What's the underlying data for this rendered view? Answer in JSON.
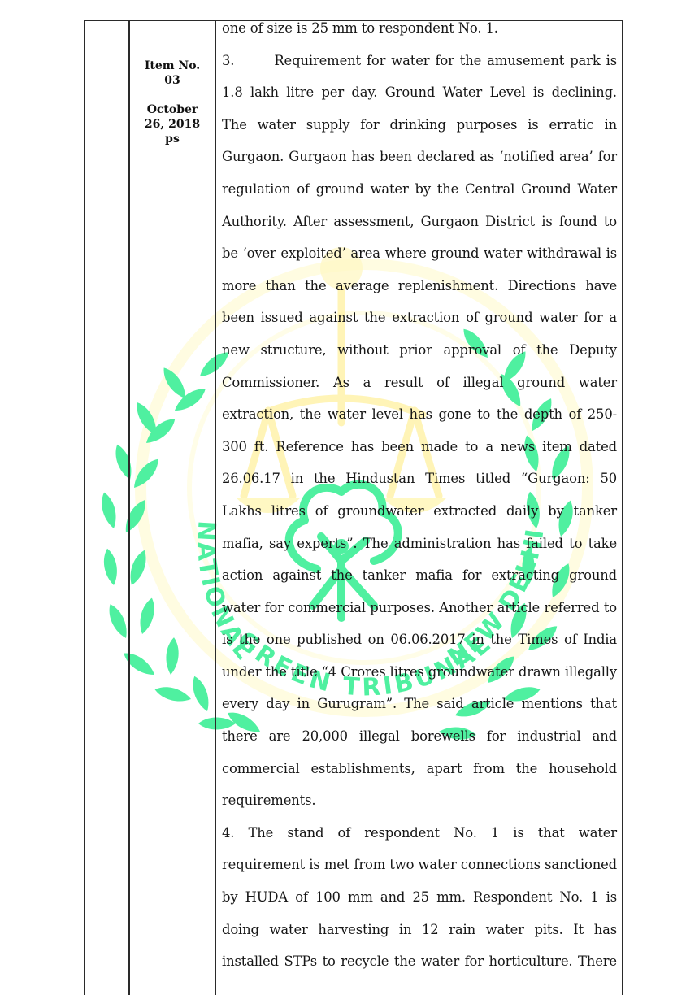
{
  "document": {
    "watermark": {
      "emblem": "national-green-tribunal-seal",
      "ring_text_left": "NATIONAL",
      "ring_text_bottom": "GREEN TRIBUNAL",
      "ring_text_right": "NEW DELHI",
      "leaf_color": "#4ff0a0",
      "scales_color": "#fff6a8"
    },
    "side_column": {
      "item_label": "Item No.",
      "item_number": "03",
      "date_line1": "October",
      "date_line2": "26, 2018",
      "initials": "ps"
    },
    "body_lines": [
      {
        "text": "one of size is 25 mm to respondent No. 1.",
        "justified": false
      },
      {
        "text": "3.       Requirement for water for the amusement park is",
        "justified": true
      },
      {
        "text": "1.8 lakh litre per day.  Ground Water Level is declining.",
        "justified": true
      },
      {
        "text": "The water supply for drinking purposes is erratic in",
        "justified": true
      },
      {
        "text": "Gurgaon.  Gurgaon has been declared as ‘notified area’ for",
        "justified": true
      },
      {
        "text": "regulation of ground water by the Central Ground Water",
        "justified": true
      },
      {
        "text": "Authority. After assessment, Gurgaon District is found to",
        "justified": true
      },
      {
        "text": "be ‘over exploited’ area where ground water withdrawal is",
        "justified": true
      },
      {
        "text": "more than the average replenishment.  Directions have",
        "justified": true
      },
      {
        "text": "been issued against the extraction of ground water for a",
        "justified": true
      },
      {
        "text": "new structure, without prior approval of the Deputy",
        "justified": true
      },
      {
        "text": "Commissioner.  As a result of illegal ground water",
        "justified": true
      },
      {
        "text": "extraction, the water level has gone to the depth of 250-",
        "justified": true
      },
      {
        "text": "300 ft.  Reference has been made to a news item dated",
        "justified": true
      },
      {
        "text": "26.06.17 in the Hindustan Times titled “Gurgaon: 50",
        "justified": true
      },
      {
        "text": "Lakhs litres of groundwater extracted daily by tanker",
        "justified": true
      },
      {
        "text": "mafia, say experts”.  The administration has failed to take",
        "justified": true
      },
      {
        "text": "action against the tanker mafia for extracting ground",
        "justified": true
      },
      {
        "text": "water for commercial purposes.  Another article referred to",
        "justified": true
      },
      {
        "text": "is the one published on 06.06.2017 in the Times of India",
        "justified": true
      },
      {
        "text": "under the title “4 Crores litres groundwater drawn illegally",
        "justified": true
      },
      {
        "text": "every day in Gurugram”.  The said article mentions that",
        "justified": true
      },
      {
        "text": "there are 20,000 illegal borewells for industrial and",
        "justified": true
      },
      {
        "text": "commercial establishments, apart from the household",
        "justified": true
      },
      {
        "text": "requirements.",
        "justified": false
      },
      {
        "text": "4. The stand of respondent No. 1 is that water",
        "justified": true
      },
      {
        "text": "requirement is met from two water connections sanctioned",
        "justified": true
      },
      {
        "text": "by HUDA of 100 mm and 25 mm.  Respondent No. 1 is",
        "justified": true
      },
      {
        "text": "doing water harvesting in 12 rain water pits.  It has",
        "justified": true
      },
      {
        "text": "installed STPs to recycle the water for horticulture.  There",
        "justified": true
      }
    ]
  }
}
